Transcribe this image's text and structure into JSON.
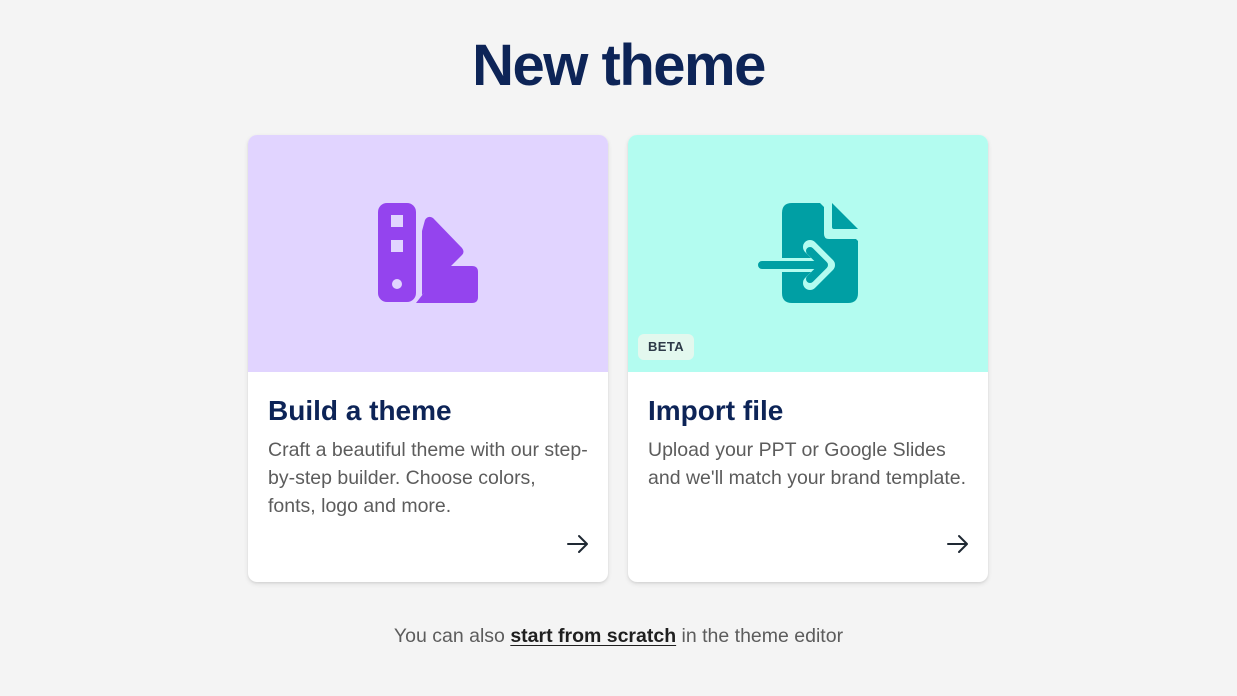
{
  "page": {
    "title": "New theme"
  },
  "cards": [
    {
      "title": "Build a theme",
      "description": "Craft a beautiful theme with our step-by-step builder. Choose colors, fonts, logo and more.",
      "icon": "color-swatch-icon",
      "hero_color": "#e1d4ff",
      "icon_color": "#9444ee",
      "arrow_icon": "arrow-right-icon"
    },
    {
      "title": "Import file",
      "description": "Upload your PPT or Google Slides and we'll match your brand template.",
      "icon": "file-import-icon",
      "hero_color": "#b3fcf0",
      "icon_color": "#009fa4",
      "badge": "BETA",
      "arrow_icon": "arrow-right-icon"
    }
  ],
  "footer": {
    "prefix": "You can also",
    "link_label": "start from scratch",
    "suffix": "in the theme editor"
  }
}
